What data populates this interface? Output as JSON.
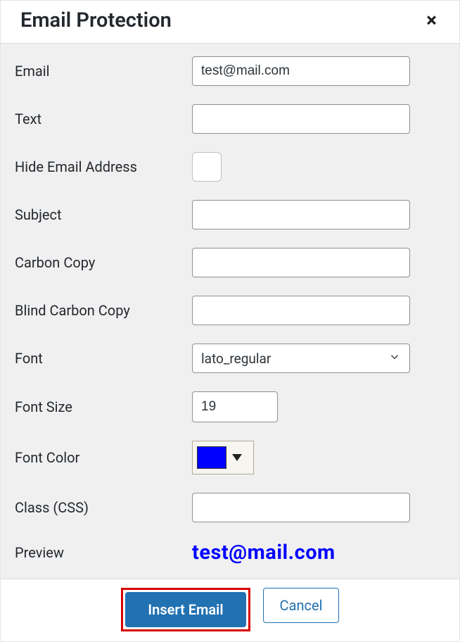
{
  "dialog": {
    "title": "Email Protection",
    "close_label": "×"
  },
  "form": {
    "email_label": "Email",
    "email_value": "test@mail.com",
    "text_label": "Text",
    "text_value": "",
    "hide_label": "Hide Email Address",
    "hide_checked": false,
    "subject_label": "Subject",
    "subject_value": "",
    "cc_label": "Carbon Copy",
    "cc_value": "",
    "bcc_label": "Blind Carbon Copy",
    "bcc_value": "",
    "font_label": "Font",
    "font_value": "lato_regular",
    "fontsize_label": "Font Size",
    "fontsize_value": "19",
    "fontcolor_label": "Font Color",
    "fontcolor_value": "#0000ff",
    "class_label": "Class (CSS)",
    "class_value": "",
    "preview_label": "Preview",
    "preview_value": "test@mail.com"
  },
  "footer": {
    "insert_label": "Insert Email",
    "cancel_label": "Cancel"
  }
}
